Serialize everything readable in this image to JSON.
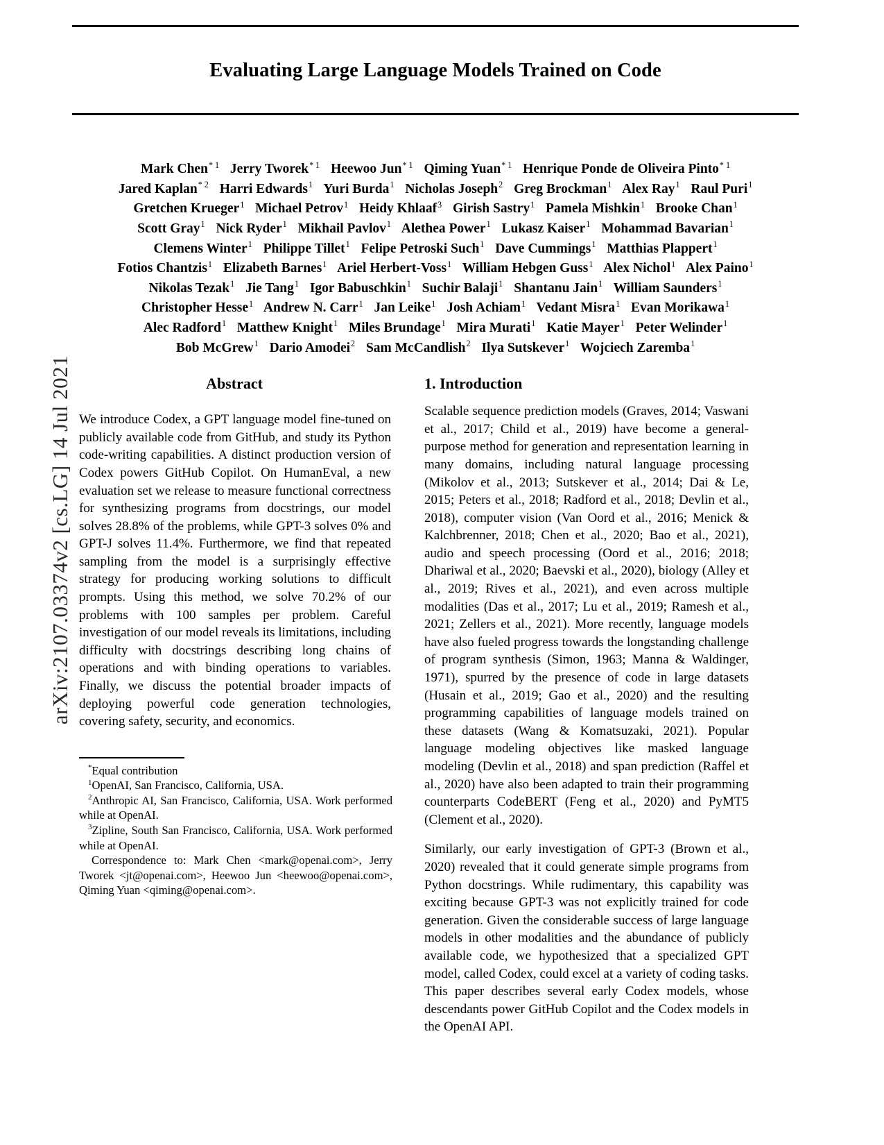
{
  "arxiv_stamp": "arXiv:2107.03374v2  [cs.LG]  14 Jul 2021",
  "title": "Evaluating Large Language Models Trained on Code",
  "authors": {
    "lines": [
      [
        {
          "name": "Mark Chen",
          "marks": "* 1"
        },
        {
          "name": "Jerry Tworek",
          "marks": "* 1"
        },
        {
          "name": "Heewoo Jun",
          "marks": "* 1"
        },
        {
          "name": "Qiming Yuan",
          "marks": "* 1"
        },
        {
          "name": "Henrique Ponde de Oliveira Pinto",
          "marks": "* 1"
        }
      ],
      [
        {
          "name": "Jared Kaplan",
          "marks": "* 2"
        },
        {
          "name": "Harri Edwards",
          "marks": "1"
        },
        {
          "name": "Yuri Burda",
          "marks": "1"
        },
        {
          "name": "Nicholas Joseph",
          "marks": "2"
        },
        {
          "name": "Greg Brockman",
          "marks": "1"
        },
        {
          "name": "Alex Ray",
          "marks": "1"
        },
        {
          "name": "Raul Puri",
          "marks": "1"
        }
      ],
      [
        {
          "name": "Gretchen Krueger",
          "marks": "1"
        },
        {
          "name": "Michael Petrov",
          "marks": "1"
        },
        {
          "name": "Heidy Khlaaf",
          "marks": "3"
        },
        {
          "name": "Girish Sastry",
          "marks": "1"
        },
        {
          "name": "Pamela Mishkin",
          "marks": "1"
        },
        {
          "name": "Brooke Chan",
          "marks": "1"
        }
      ],
      [
        {
          "name": "Scott Gray",
          "marks": "1"
        },
        {
          "name": "Nick Ryder",
          "marks": "1"
        },
        {
          "name": "Mikhail Pavlov",
          "marks": "1"
        },
        {
          "name": "Alethea Power",
          "marks": "1"
        },
        {
          "name": "Lukasz Kaiser",
          "marks": "1"
        },
        {
          "name": "Mohammad Bavarian",
          "marks": "1"
        }
      ],
      [
        {
          "name": "Clemens Winter",
          "marks": "1"
        },
        {
          "name": "Philippe Tillet",
          "marks": "1"
        },
        {
          "name": "Felipe Petroski Such",
          "marks": "1"
        },
        {
          "name": "Dave Cummings",
          "marks": "1"
        },
        {
          "name": "Matthias Plappert",
          "marks": "1"
        }
      ],
      [
        {
          "name": "Fotios Chantzis",
          "marks": "1"
        },
        {
          "name": "Elizabeth Barnes",
          "marks": "1"
        },
        {
          "name": "Ariel Herbert-Voss",
          "marks": "1"
        },
        {
          "name": "William Hebgen Guss",
          "marks": "1"
        },
        {
          "name": "Alex Nichol",
          "marks": "1"
        },
        {
          "name": "Alex Paino",
          "marks": "1"
        }
      ],
      [
        {
          "name": "Nikolas Tezak",
          "marks": "1"
        },
        {
          "name": "Jie Tang",
          "marks": "1"
        },
        {
          "name": "Igor Babuschkin",
          "marks": "1"
        },
        {
          "name": "Suchir Balaji",
          "marks": "1"
        },
        {
          "name": "Shantanu Jain",
          "marks": "1"
        },
        {
          "name": "William Saunders",
          "marks": "1"
        }
      ],
      [
        {
          "name": "Christopher Hesse",
          "marks": "1"
        },
        {
          "name": "Andrew N. Carr",
          "marks": "1"
        },
        {
          "name": "Jan Leike",
          "marks": "1"
        },
        {
          "name": "Josh Achiam",
          "marks": "1"
        },
        {
          "name": "Vedant Misra",
          "marks": "1"
        },
        {
          "name": "Evan Morikawa",
          "marks": "1"
        }
      ],
      [
        {
          "name": "Alec Radford",
          "marks": "1"
        },
        {
          "name": "Matthew Knight",
          "marks": "1"
        },
        {
          "name": "Miles Brundage",
          "marks": "1"
        },
        {
          "name": "Mira Murati",
          "marks": "1"
        },
        {
          "name": "Katie Mayer",
          "marks": "1"
        },
        {
          "name": "Peter Welinder",
          "marks": "1"
        }
      ],
      [
        {
          "name": "Bob McGrew",
          "marks": "1"
        },
        {
          "name": "Dario Amodei",
          "marks": "2"
        },
        {
          "name": "Sam McCandlish",
          "marks": "2"
        },
        {
          "name": "Ilya Sutskever",
          "marks": "1"
        },
        {
          "name": "Wojciech Zaremba",
          "marks": "1"
        }
      ]
    ]
  },
  "abstract": {
    "heading": "Abstract",
    "body": "We introduce Codex, a GPT language model fine-tuned on publicly available code from GitHub, and study its Python code-writing capabilities. A distinct production version of Codex powers GitHub Copilot. On HumanEval, a new evaluation set we release to measure functional correctness for synthesizing programs from docstrings, our model solves 28.8% of the problems, while GPT-3 solves 0% and GPT-J solves 11.4%. Furthermore, we find that repeated sampling from the model is a surprisingly effective strategy for producing working solutions to difficult prompts. Using this method, we solve 70.2% of our problems with 100 samples per problem. Careful investigation of our model reveals its limitations, including difficulty with docstrings describing long chains of operations and with binding operations to variables. Finally, we discuss the potential broader impacts of deploying powerful code generation technologies, covering safety, security, and economics."
  },
  "footnotes": {
    "equal_contribution": "Equal contribution",
    "affiliation_1": "OpenAI, San Francisco, California, USA.",
    "affiliation_2": "Anthropic AI, San Francisco, California, USA. Work performed while at OpenAI.",
    "affiliation_3": "Zipline, South San Francisco, California, USA. Work performed while at OpenAI.",
    "correspondence": "Correspondence to: Mark Chen <mark@openai.com>, Jerry Tworek <jt@openai.com>, Heewoo Jun <heewoo@openai.com>, Qiming Yuan <qiming@openai.com>."
  },
  "introduction": {
    "heading": "1. Introduction",
    "paragraphs": [
      "Scalable sequence prediction models (Graves, 2014; Vaswani et al., 2017; Child et al., 2019) have become a general-purpose method for generation and representation learning in many domains, including natural language processing (Mikolov et al., 2013; Sutskever et al., 2014; Dai & Le, 2015; Peters et al., 2018; Radford et al., 2018; Devlin et al., 2018), computer vision (Van Oord et al., 2016; Menick & Kalchbrenner, 2018; Chen et al., 2020; Bao et al., 2021), audio and speech processing (Oord et al., 2016; 2018; Dhariwal et al., 2020; Baevski et al., 2020), biology (Alley et al., 2019; Rives et al., 2021), and even across multiple modalities (Das et al., 2017; Lu et al., 2019; Ramesh et al., 2021; Zellers et al., 2021). More recently, language models have also fueled progress towards the longstanding challenge of program synthesis (Simon, 1963; Manna & Waldinger, 1971), spurred by the presence of code in large datasets (Husain et al., 2019; Gao et al., 2020) and the resulting programming capabilities of language models trained on these datasets (Wang & Komatsuzaki, 2021). Popular language modeling objectives like masked language modeling (Devlin et al., 2018) and span prediction (Raffel et al., 2020) have also been adapted to train their programming counterparts CodeBERT (Feng et al., 2020) and PyMT5 (Clement et al., 2020).",
      "Similarly, our early investigation of GPT-3 (Brown et al., 2020) revealed that it could generate simple programs from Python docstrings. While rudimentary, this capability was exciting because GPT-3 was not explicitly trained for code generation. Given the considerable success of large language models in other modalities and the abundance of publicly available code, we hypothesized that a specialized GPT model, called Codex, could excel at a variety of coding tasks. This paper describes several early Codex models, whose descendants power GitHub Copilot and the Codex models in the OpenAI API."
    ]
  }
}
